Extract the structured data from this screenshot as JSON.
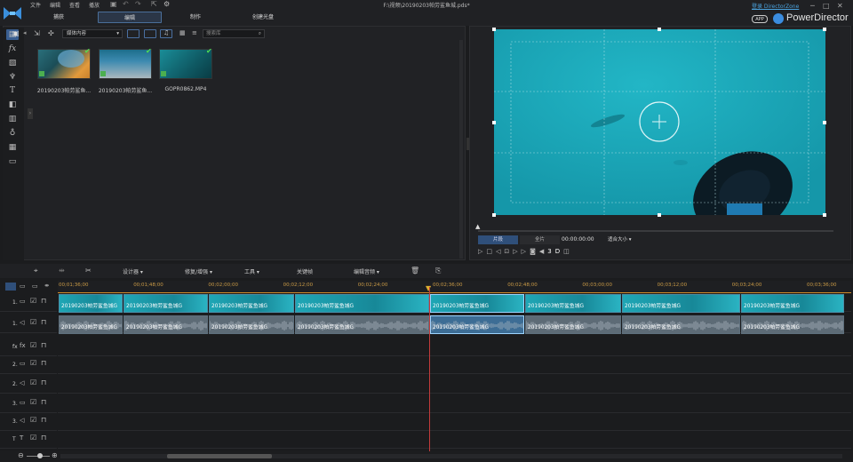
{
  "menu": [
    "文件",
    "编辑",
    "查看",
    "播放"
  ],
  "mode_tabs": [
    "捕获",
    "编辑",
    "制作",
    "创建光盘"
  ],
  "file_title": "F:\\视频\\20190203帕劳鲨鱼城.pds*",
  "director_zone": "登录 DirectorZone",
  "app_badge": "APP",
  "app_name": "PowerDirector",
  "library": {
    "media_dropdown": "媒体内容",
    "search_placeholder": "搜索库",
    "items": [
      {
        "label": "20190203帕劳鲨鱼..."
      },
      {
        "label": "20190203帕劳鲨鱼..."
      },
      {
        "label": "GOPR0862.MP4"
      }
    ]
  },
  "preview": {
    "clip_btn": "片段",
    "movie_btn": "全片",
    "timecode": "00:00:00:00",
    "fit": "适合大小"
  },
  "timeline_toolbar": {
    "designer": "设计器",
    "fix": "修复/增强",
    "tools": "工具",
    "keyframe": "关键帧",
    "edit_audio": "编辑音频"
  },
  "ruler": [
    "00;01;36;00",
    "00;01;48;00",
    "00;02;00;00",
    "00;02;12;00",
    "00;02;24;00",
    "00;02;36;00",
    "00;02;48;00",
    "00;03;00;00",
    "00;03;12;00",
    "00;03;24;00",
    "00;03;36;00"
  ],
  "track_labels": [
    "1.",
    "1.",
    "fx",
    "2.",
    "2.",
    "3.",
    "3.",
    "T",
    ""
  ],
  "clip_name": "20190203帕劳鲨鱼城G",
  "colors": {
    "accent": "#4aa3df",
    "water": "#1aa7b8",
    "playhead": "#c23b3b"
  }
}
